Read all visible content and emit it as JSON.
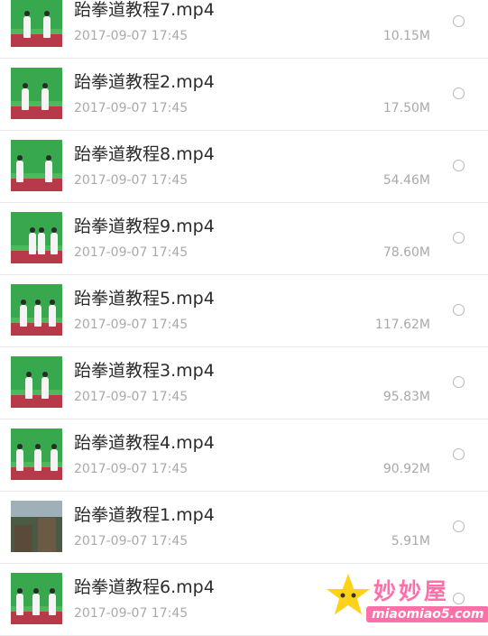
{
  "files": [
    {
      "name": "跆拳道教程7.mp4",
      "date": "2017-09-07 17:45",
      "size": "10.15M",
      "thumb": "dojo"
    },
    {
      "name": "跆拳道教程2.mp4",
      "date": "2017-09-07 17:45",
      "size": "17.50M",
      "thumb": "dojo"
    },
    {
      "name": "跆拳道教程8.mp4",
      "date": "2017-09-07 17:45",
      "size": "54.46M",
      "thumb": "dojo"
    },
    {
      "name": "跆拳道教程9.mp4",
      "date": "2017-09-07 17:45",
      "size": "78.60M",
      "thumb": "dojo"
    },
    {
      "name": "跆拳道教程5.mp4",
      "date": "2017-09-07 17:45",
      "size": "117.62M",
      "thumb": "dojo"
    },
    {
      "name": "跆拳道教程3.mp4",
      "date": "2017-09-07 17:45",
      "size": "95.83M",
      "thumb": "dojo"
    },
    {
      "name": "跆拳道教程4.mp4",
      "date": "2017-09-07 17:45",
      "size": "90.92M",
      "thumb": "dojo"
    },
    {
      "name": "跆拳道教程1.mp4",
      "date": "2017-09-07 17:45",
      "size": "5.91M",
      "thumb": "street"
    },
    {
      "name": "跆拳道教程6.mp4",
      "date": "2017-09-07 17:45",
      "size": "",
      "thumb": "dojo"
    }
  ],
  "watermark": {
    "text": "妙妙屋",
    "url": "miaomiao5.com"
  },
  "colors": {
    "thumb_green": "#38a84e",
    "thumb_floor": "#b8394a",
    "watermark_pink": "#ff6fa8",
    "star_yellow": "#ffd21a"
  }
}
